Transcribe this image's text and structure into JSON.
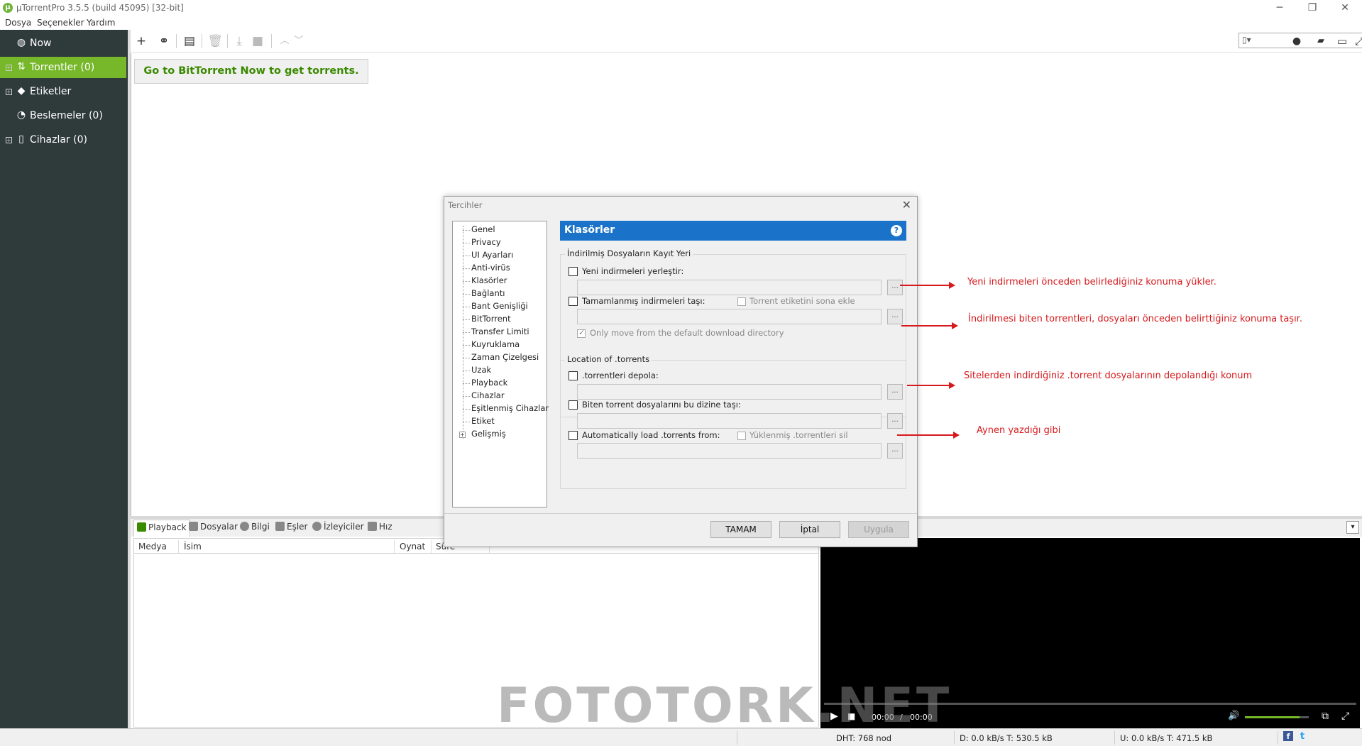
{
  "window": {
    "title": "µTorrentPro 3.5.5  (build 45095) [32-bit]",
    "logo_letter": "µ",
    "controls": {
      "minimize": "─",
      "maximize": "❐",
      "close": "✕"
    }
  },
  "menu": [
    "Dosya",
    "Seçenekler",
    "Yardım"
  ],
  "sidebar": {
    "items": [
      {
        "label": "Now",
        "icon": "globe-icon",
        "glyph": "◍"
      },
      {
        "label": "Torrentler (0)",
        "icon": "transfer-icon",
        "glyph": "⇅",
        "active": true
      },
      {
        "label": "Etiketler",
        "icon": "tag-icon",
        "glyph": "◆"
      },
      {
        "label": "Beslemeler (0)",
        "icon": "rss-icon",
        "glyph": "◔"
      },
      {
        "label": "Cihazlar (0)",
        "icon": "phone-icon",
        "glyph": "▯"
      }
    ]
  },
  "toolbar": {
    "glyphs": {
      "add": "+",
      "link": "⚭",
      "create": "▤",
      "delete": "🗑",
      "download": "⤓",
      "stop": "■",
      "up": "︿",
      "down": "﹀",
      "search": "⚲",
      "bulb": "●",
      "chat": "▰",
      "monitor": "▭",
      "expand": "⤢"
    }
  },
  "main": {
    "promo_button": "Go to BitTorrent Now to get torrents."
  },
  "bottom_tabs": [
    "Playback",
    "Dosyalar",
    "Bilgi",
    "Eşler",
    "İzleyiciler",
    "Hız"
  ],
  "playlist_columns": [
    "Medya",
    "İsim",
    "Oynat",
    "Süre"
  ],
  "video": {
    "elapsed": "00:00",
    "sep": "/",
    "total": "00:00",
    "volume_level": 0.85,
    "play": "▶",
    "stop": "■",
    "volume": "🔊",
    "popout": "⧉",
    "fullscreen": "⤢"
  },
  "statusbar": {
    "dht": "DHT: 768 nod",
    "down": "D: 0.0 kB/s T: 530.5 kB",
    "up": "U: 0.0 kB/s T: 471.5 kB",
    "fb": "f",
    "tw": "t"
  },
  "dialog": {
    "title": "Tercihler",
    "close": "✕",
    "nav": [
      "Genel",
      "Privacy",
      "UI Ayarları",
      "Anti-virüs",
      "Klasörler",
      "Bağlantı",
      "Bant Genişliği",
      "BitTorrent",
      "Transfer Limiti",
      "Kuyruklama",
      "Zaman Çizelgesi",
      "Uzak",
      "Playback",
      "Cihazlar",
      "Eşitlenmiş Cihazlar",
      "Etiket",
      "Gelişmiş"
    ],
    "nav_expander": "+",
    "header": "Klasörler",
    "help": "?",
    "group1_title": "İndirilmiş Dosyaların Kayıt Yeri",
    "opt_new_downloads": "Yeni indirmeleri yerleştir:",
    "opt_move_completed": "Tamamlanmış indirmeleri taşı:",
    "opt_append_label": "Torrent etiketini sona ekle",
    "opt_only_default": "Only move from the default download directory",
    "group2_title": "Location of .torrents",
    "opt_store_torrents": ".torrentleri depola:",
    "opt_move_finished": "Biten torrent dosyalarını bu dizine taşı:",
    "opt_autoload": "Automatically load .torrents from:",
    "opt_delete_loaded": "Yüklenmiş .torrentleri sil",
    "browse": "...",
    "ok": "TAMAM",
    "cancel": "İptal",
    "apply": "Uygula"
  },
  "annotations": [
    "Yeni indirmeleri önceden belirlediğiniz konuma yükler.",
    "İndirilmesi biten torrentleri, dosyaları önceden belirttiğiniz konuma taşır.",
    "Sitelerden indirdiğiniz .torrent dosyalarının depolandığı konum",
    "Aynen yazdığı gibi"
  ],
  "watermark": "FOTOTORK.NET",
  "colors": {
    "accent_green": "#76b82a",
    "header_blue": "#1a73c9",
    "annotation_red": "#d7191c",
    "sidebar_bg": "#2f3a3b"
  }
}
